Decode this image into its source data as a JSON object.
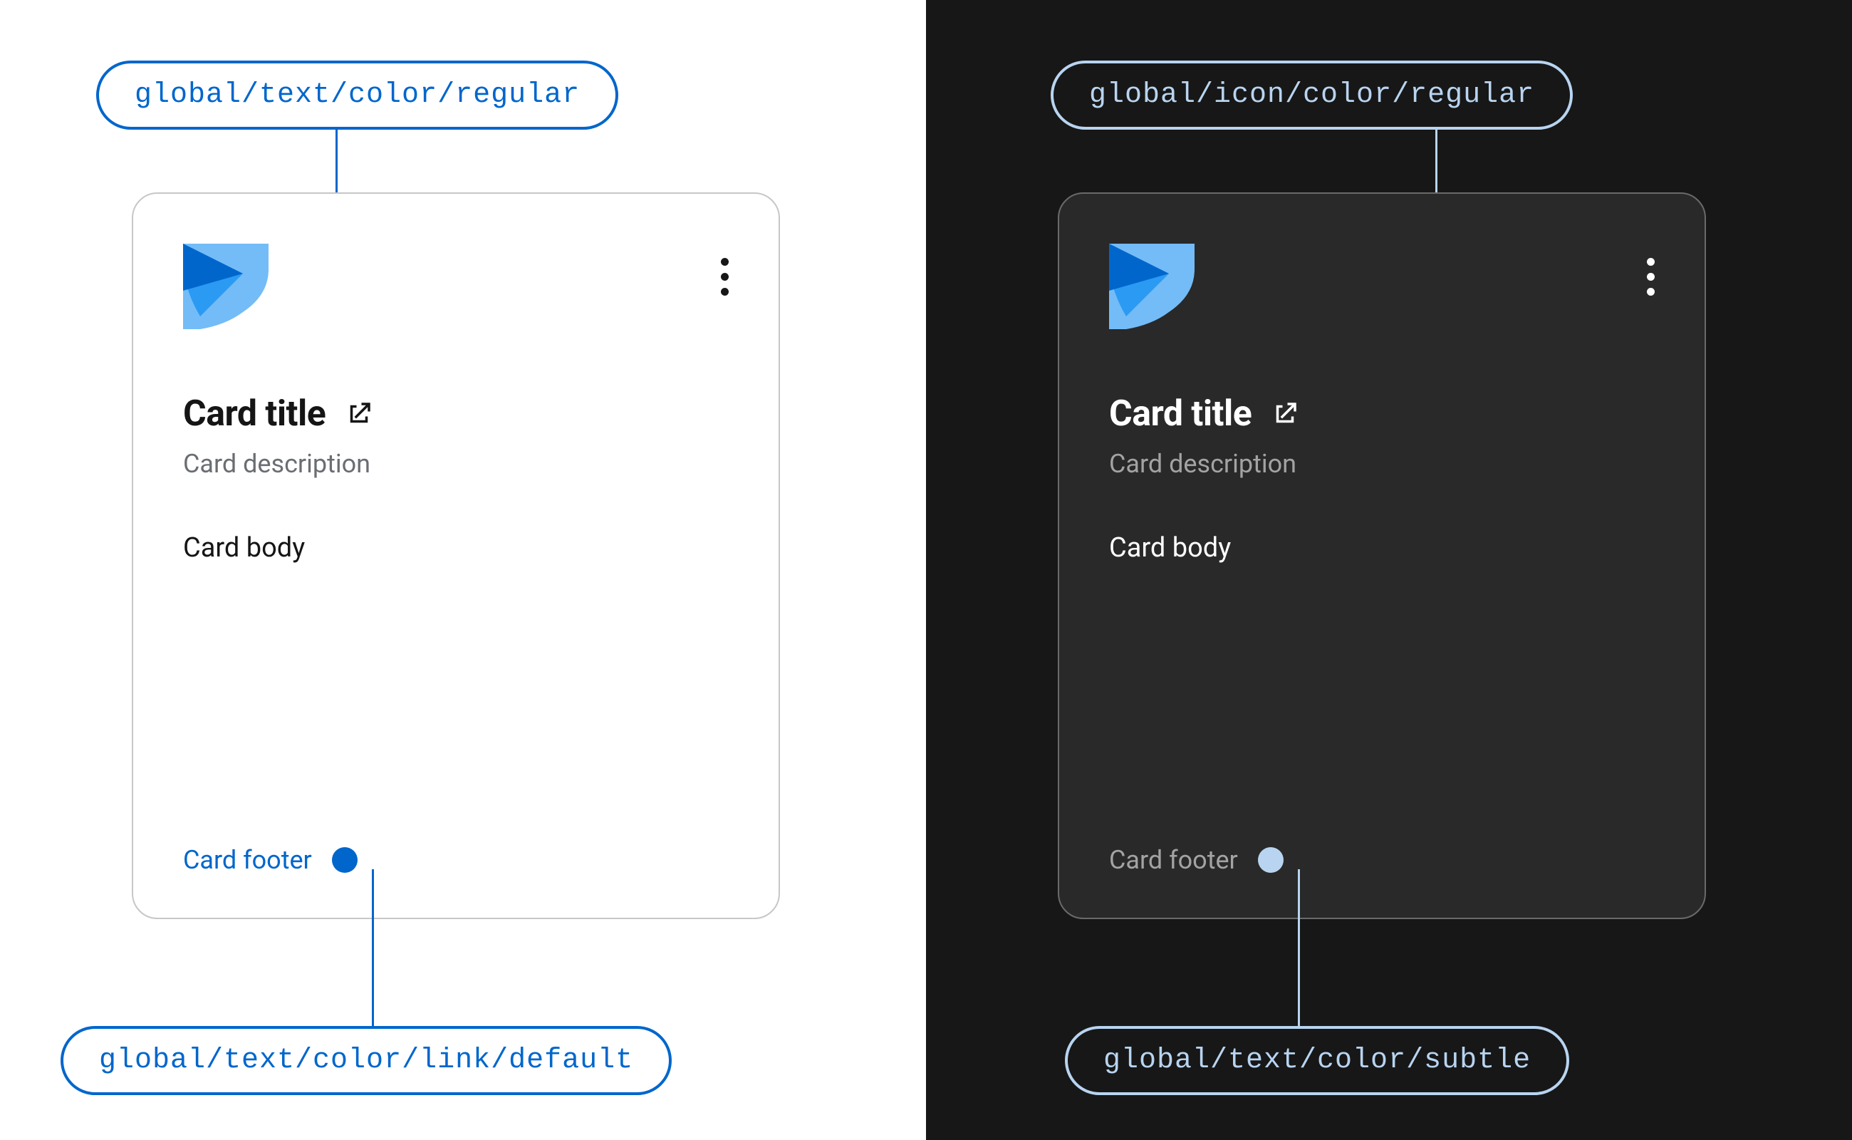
{
  "annotations": {
    "light_top": "global/text/color/regular",
    "light_bottom": "global/text/color/link/default",
    "dark_top": "global/icon/color/regular",
    "dark_bottom": "global/text/color/subtle"
  },
  "card": {
    "title": "Card title",
    "description": "Card description",
    "body": "Card body",
    "footer": "Card footer"
  },
  "icons": {
    "kebab": "kebab-menu-icon",
    "external": "external-link-icon",
    "logo": "app-logo-icon"
  }
}
